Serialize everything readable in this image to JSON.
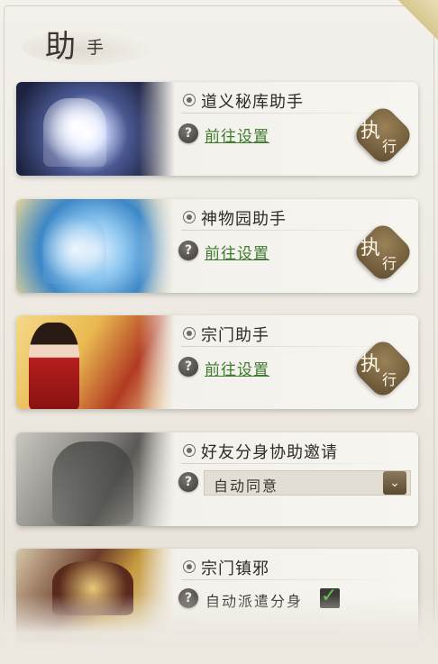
{
  "panel": {
    "title_big": "助",
    "title_small": "手"
  },
  "cards": [
    {
      "name": "道义秘库助手",
      "link": "前往设置",
      "exec_top": "执",
      "exec_bottom": "行"
    },
    {
      "name": "神物园助手",
      "link": "前往设置",
      "exec_top": "执",
      "exec_bottom": "行"
    },
    {
      "name": "宗门助手",
      "link": "前往设置",
      "exec_top": "执",
      "exec_bottom": "行"
    },
    {
      "name": "好友分身协助邀请",
      "dropdown_value": "自动同意"
    },
    {
      "name": "宗门镇邪",
      "checkbox_label": "自动派遣分身",
      "checkbox_checked": true
    }
  ],
  "icons": {
    "help": "?",
    "dropdown_arrow": "⌄"
  },
  "colors": {
    "link_green": "#3f7a2e",
    "seal_brown": "#6e5836",
    "check_green": "#5ec44a"
  }
}
